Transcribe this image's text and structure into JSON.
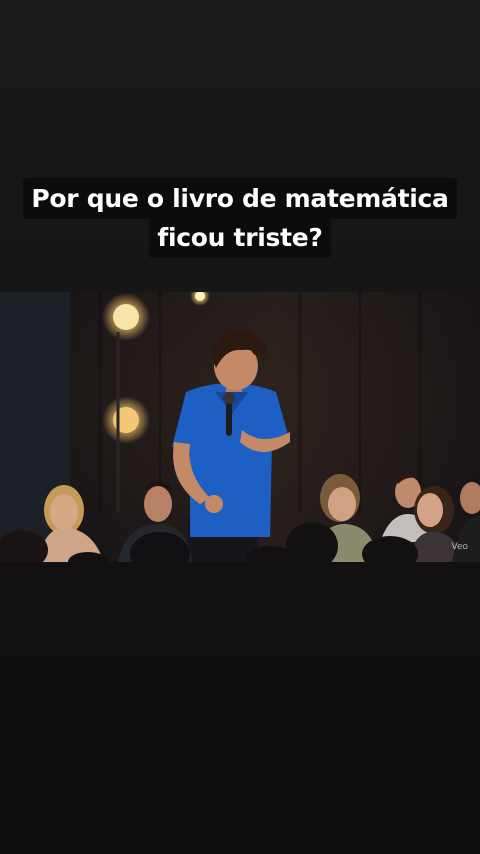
{
  "caption": {
    "line1": "Por que o livro de matemática",
    "line2": "ficou triste?"
  },
  "video": {
    "watermark": "Veo"
  },
  "colors": {
    "background": "#141214",
    "caption_bg": "#0c0c0d",
    "caption_text": "#ffffff",
    "shirt": "#1e5fc4"
  }
}
